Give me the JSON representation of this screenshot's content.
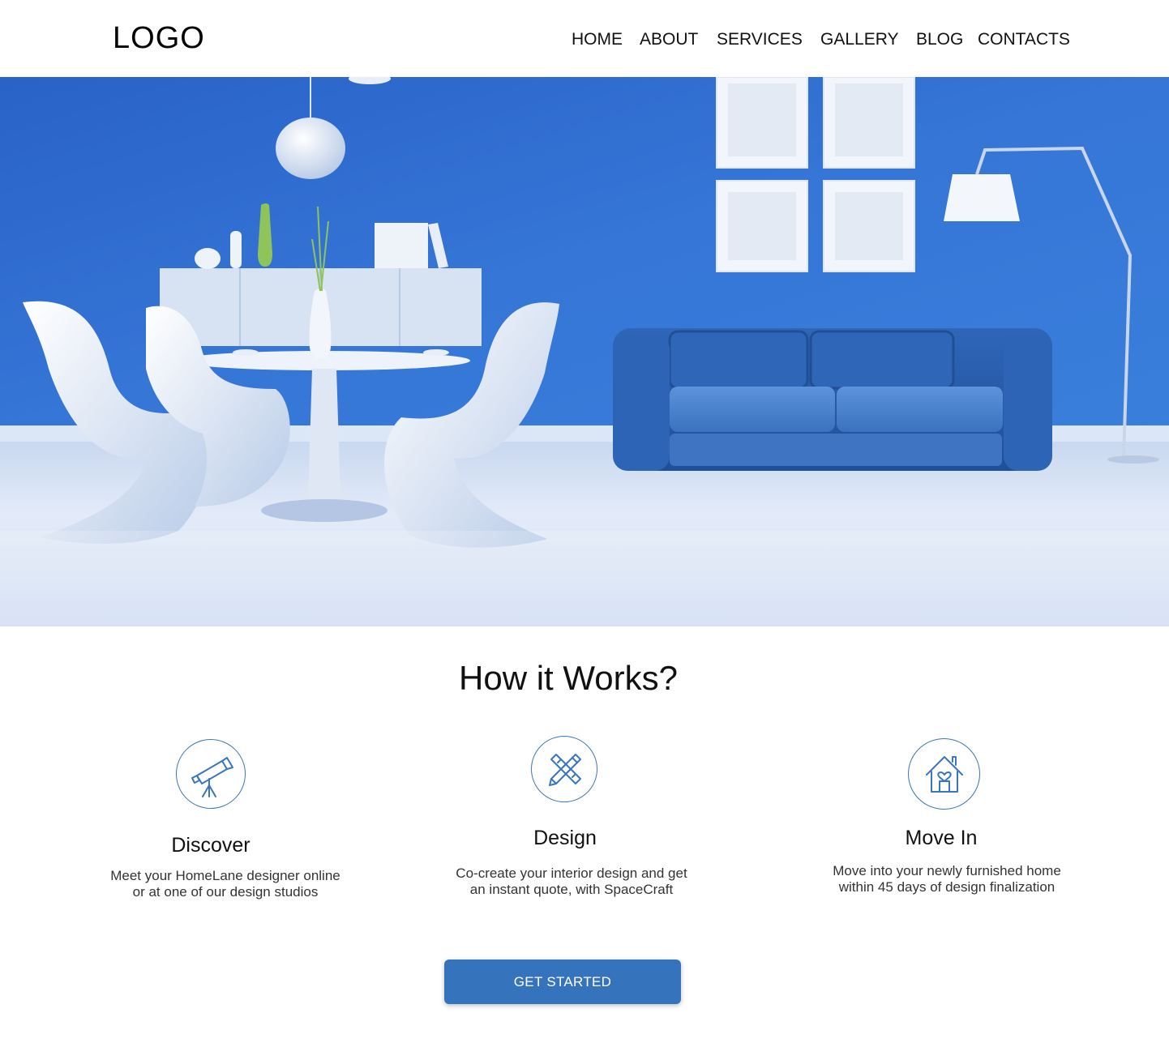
{
  "header": {
    "logo": "LOGO",
    "nav": [
      "HOME",
      "ABOUT",
      "SERVICES",
      "GALLERY",
      "BLOG",
      "CONTACTS"
    ]
  },
  "how_it_works": {
    "title": "How it Works?",
    "steps": [
      {
        "icon": "telescope-icon",
        "title": "Discover",
        "desc": [
          "Meet your HomeLane designer online",
          "or at one of our design studios"
        ]
      },
      {
        "icon": "pencil-ruler-icon",
        "title": "Design",
        "desc": [
          "Co-create your interior design and get",
          "an instant quote, with SpaceCraft"
        ]
      },
      {
        "icon": "home-heart-icon",
        "title": "Move In",
        "desc": [
          "Move into your newly furnished home",
          "within 45 days of design finalization"
        ]
      }
    ]
  },
  "cta": {
    "label": "GET STARTED"
  },
  "colors": {
    "accent": "#3574bd",
    "icon_stroke": "#3a75bf",
    "hero_wall": "#2f6fd0"
  }
}
